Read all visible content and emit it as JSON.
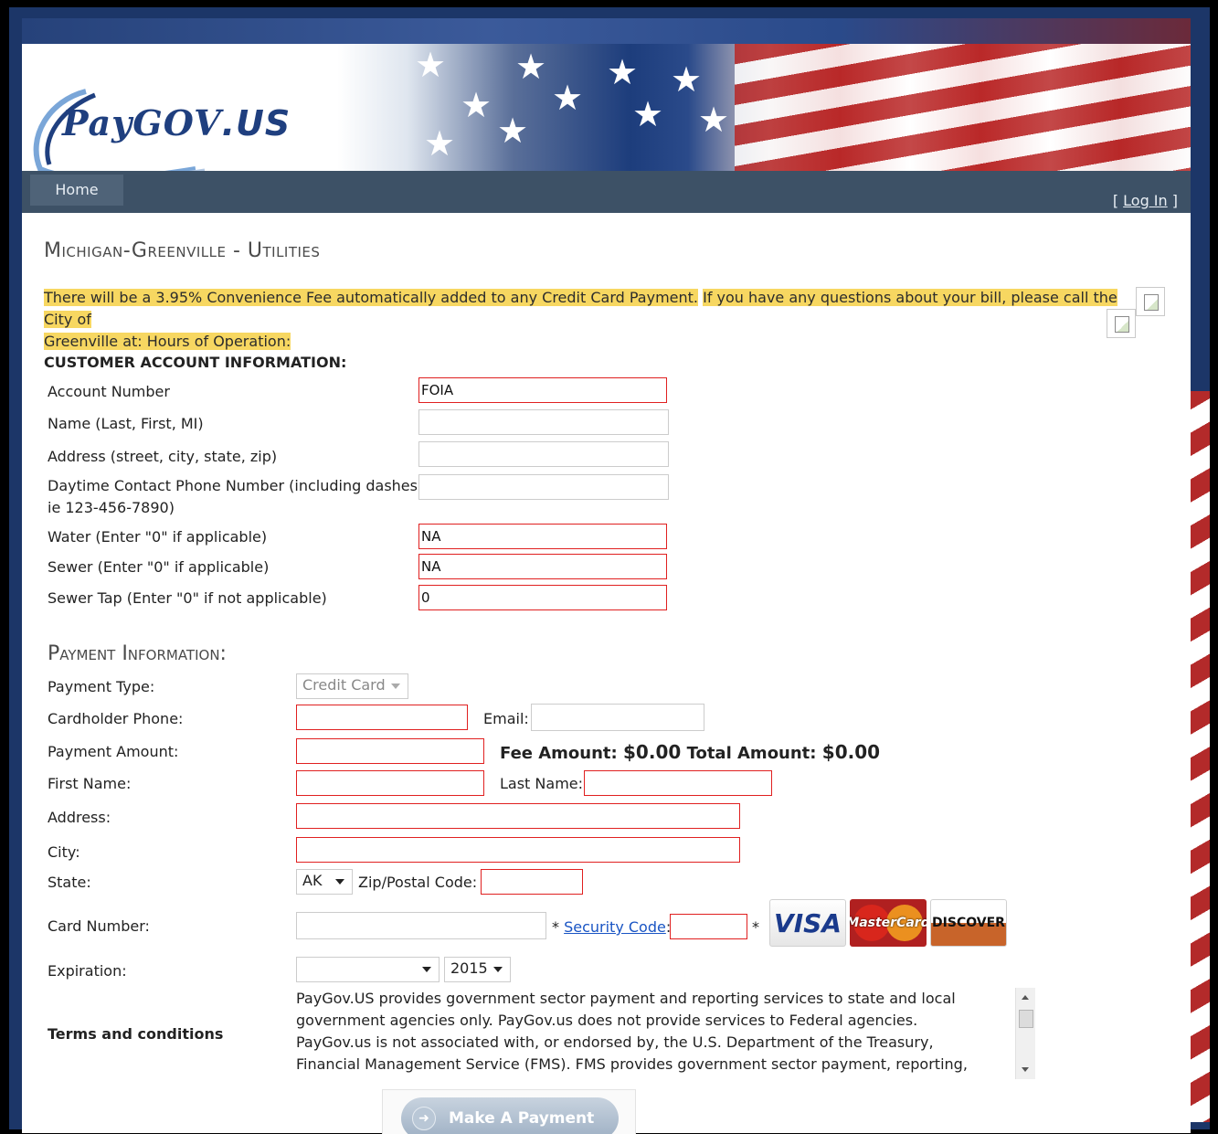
{
  "brand": {
    "logo_text": "PayGOV",
    "logo_suffix": ".US"
  },
  "nav": {
    "home": "Home",
    "login_prefix": "[ ",
    "login": "Log In",
    "login_suffix": " ]"
  },
  "page_title": "Michigan-Greenville - Utilities",
  "notice": {
    "part1": "There will be a 3.95% Convenience Fee automatically added to any Credit Card Payment.",
    "part2a": "If you have any questions about your bill, please call the City of",
    "part2b": "Greenville at: Hours of Operation:"
  },
  "customer": {
    "heading": "CUSTOMER ACCOUNT INFORMATION:",
    "fields": [
      {
        "label": "Account Number",
        "value": "FOIA"
      },
      {
        "label": "Name (Last, First, MI)",
        "value": ""
      },
      {
        "label": "Address (street, city, state, zip)",
        "value": ""
      },
      {
        "label_line1": "Daytime Contact Phone Number (including dashes,",
        "label_line2": "ie 123-456-7890)",
        "value": ""
      },
      {
        "label": "Water (Enter \"0\" if applicable)",
        "value": "NA"
      },
      {
        "label": "Sewer (Enter \"0\" if applicable)",
        "value": "NA"
      },
      {
        "label": "Sewer Tap (Enter \"0\" if not applicable)",
        "value": "0"
      }
    ]
  },
  "payment": {
    "heading": "Payment Information:",
    "payment_type_label": "Payment Type:",
    "payment_type_value": "Credit Card",
    "cardholder_phone_label": "Cardholder Phone:",
    "email_label": "Email:",
    "payment_amount_label": "Payment Amount:",
    "fee_amount_label": "Fee Amount:",
    "fee_amount_value": "$0.00",
    "total_amount_label": "Total Amount:",
    "total_amount_value": "$0.00",
    "first_name_label": "First Name:",
    "last_name_label": "Last Name:",
    "address_label": "Address:",
    "city_label": "City:",
    "state_label": "State:",
    "state_value": "AK",
    "zip_label": "Zip/Postal Code:",
    "card_number_label": "Card Number:",
    "asterisk": "*",
    "security_code_link": "Security Code",
    "colon": ":",
    "cards": [
      "VISA",
      "MasterCard",
      "DISCOVER"
    ],
    "expiration_label": "Expiration:",
    "expiration_month": "",
    "expiration_year": "2015",
    "terms_label": "Terms and conditions",
    "terms_text": "PayGov.US provides government sector payment and reporting services to state and local government agencies only. PayGov.us does not provide services to Federal agencies. PayGov.us is not associated with, or endorsed by, the U.S. Department of the Treasury, Financial Management Service (FMS). FMS provides government sector payment, reporting, and other services, to Federal",
    "submit_label": "Make A Payment"
  },
  "colors": {
    "nav_bg": "#3d5166",
    "highlight": "#f7d761",
    "required_border": "#e02020",
    "link": "#1a55c4"
  }
}
